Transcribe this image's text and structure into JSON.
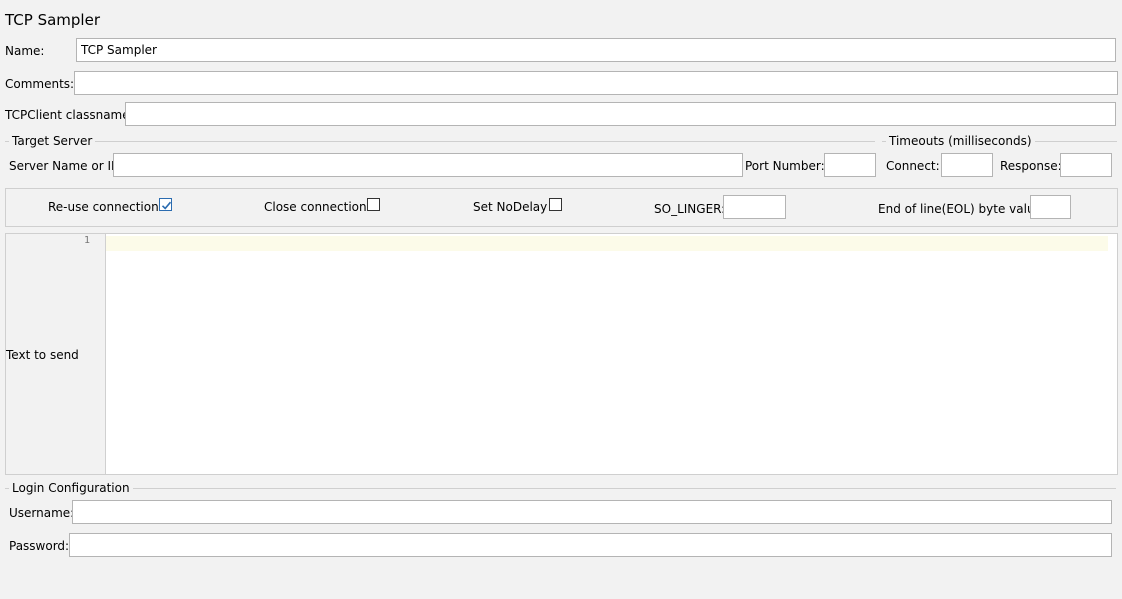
{
  "page": {
    "title": "TCP Sampler"
  },
  "fields": {
    "name": {
      "label": "Name:",
      "value": "TCP Sampler"
    },
    "comments": {
      "label": "Comments:",
      "value": ""
    },
    "classname": {
      "label": "TCPClient classname:",
      "value": ""
    }
  },
  "target_server": {
    "title": "Target Server",
    "server_label": "Server Name or IP:",
    "server_value": "",
    "port_label": "Port Number:",
    "port_value": ""
  },
  "timeouts": {
    "title": "Timeouts (milliseconds)",
    "connect_label": "Connect:",
    "connect_value": "",
    "response_label": "Response:",
    "response_value": ""
  },
  "options": {
    "reuse_label": "Re-use connection",
    "reuse_checked": true,
    "close_label": "Close connection",
    "close_checked": false,
    "nodelay_label": "Set NoDelay",
    "nodelay_checked": false,
    "solinger_label": "SO_LINGER:",
    "solinger_value": "",
    "eol_label": "End of line(EOL) byte value:",
    "eol_value": ""
  },
  "text_to_send": {
    "label": "Text to send",
    "line_number": "1"
  },
  "login": {
    "title": "Login Configuration",
    "username_label": "Username:",
    "username_value": "",
    "password_label": "Password:",
    "password_value": ""
  },
  "colors": {
    "check_accent": "#2b6cb0",
    "current_line": "#fcfbe9"
  }
}
